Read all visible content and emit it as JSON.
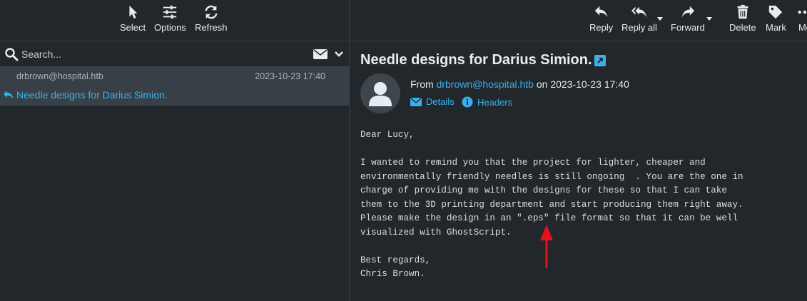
{
  "left_toolbar": {
    "select_label": "Select",
    "options_label": "Options",
    "refresh_label": "Refresh"
  },
  "right_toolbar": {
    "reply_label": "Reply",
    "reply_all_label": "Reply all",
    "forward_label": "Forward",
    "delete_label": "Delete",
    "mark_label": "Mark",
    "more_label": "Mo"
  },
  "search": {
    "placeholder": "Search..."
  },
  "message_list": [
    {
      "from": "drbrown@hospital.htb",
      "date": "2023-10-23 17:40",
      "subject": "Needle designs for Darius Simion."
    }
  ],
  "message": {
    "subject": "Needle designs for Darius Simion.",
    "from_prefix": "From",
    "from_address": "drbrown@hospital.htb",
    "on_text": "on 2023-10-23 17:40",
    "details_label": "Details",
    "headers_label": "Headers",
    "body": "Dear Lucy,\n\nI wanted to remind you that the project for lighter, cheaper and\nenvironmentally friendly needles is still ongoing  . You are the one in\ncharge of providing me with the designs for these so that I can take\nthem to the 3D printing department and start producing them right away.\nPlease make the design in an \".eps\" file format so that it can be well\nvisualized with GhostScript.\n\nBest regards,\nChris Brown."
  },
  "colors": {
    "background": "#21272b",
    "selected_row": "#374047",
    "accent": "#3bb0f0",
    "annotation_arrow": "#e8101a"
  }
}
